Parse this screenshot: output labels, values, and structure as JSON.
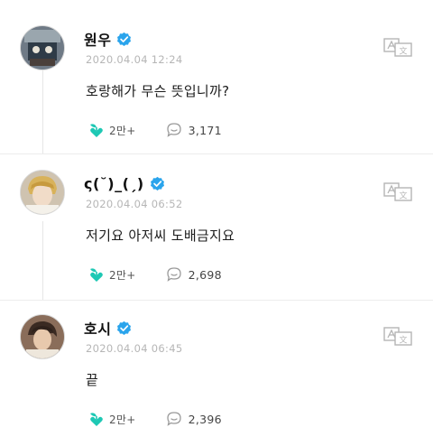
{
  "colors": {
    "accent": "#1ec8b4",
    "verified": "#2aa4ec",
    "muted": "#b6b6b6",
    "text": "#1c1c1c"
  },
  "icons": {
    "verified": "verified-check-icon",
    "translate": "translate-icon",
    "like": "sprout-heart-icon",
    "reply": "speech-bubble-icon"
  },
  "posts": [
    {
      "username": "원우",
      "timestamp": "2020.04.04 12:24",
      "message": "호랑해가 무슨 뜻입니까?",
      "likes": "2만+",
      "replies": "3,171"
    },
    {
      "username": "ς(˘)_(ˏ)",
      "timestamp": "2020.04.04 06:52",
      "message": "저기요 아저씨 도배금지요",
      "likes": "2만+",
      "replies": "2,698"
    },
    {
      "username": "호시",
      "timestamp": "2020.04.04 06:45",
      "message": "끝",
      "likes": "2만+",
      "replies": "2,396"
    }
  ]
}
